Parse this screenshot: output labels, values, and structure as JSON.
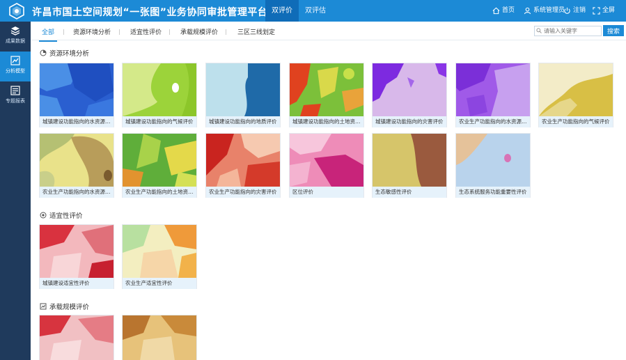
{
  "header": {
    "title": "许昌市国土空间规划“一张图”业务协同审批管理平台",
    "tabs": [
      "双评价",
      "双评估"
    ],
    "links": {
      "home": "首页",
      "user": "系统管理员",
      "logout": "注销",
      "fullscreen": "全屏"
    },
    "bg_color": "#1c8ad6"
  },
  "sidebar": {
    "items": [
      {
        "label": "成果数据",
        "icon": "layers-icon"
      },
      {
        "label": "分析模型",
        "icon": "chart-icon"
      },
      {
        "label": "专题报表",
        "icon": "report-icon"
      }
    ],
    "active_index": 1
  },
  "filters": {
    "tabs": [
      "全部",
      "资源环境分析",
      "适宜性评价",
      "承载规模评价",
      "三区三线划定"
    ],
    "active_index": 0,
    "search_placeholder": "请输入关键字",
    "search_button": "搜索"
  },
  "sections": [
    {
      "title": "资源环境分析",
      "icon": "pie-chart-icon",
      "cards": [
        "城镇建设功能指向的水资源评价",
        "城镇建设功能指向的气候评价",
        "城镇建设功能指向的地质评价",
        "城镇建设功能指向的土地资源评价",
        "城镇建设功能指向的灾害评价",
        "农业生产功能指向的水资源评价",
        "农业生产功能指向的气候评价",
        "农业生产功能指向的水资源评价",
        "农业生产功能指向的土地资源评价",
        "农业生产功能指向的灾害评价",
        "区位评价",
        "生态敏感性评价",
        "生态系统服务功能重要性评价"
      ]
    },
    {
      "title": "适宜性评价",
      "icon": "target-icon",
      "cards": [
        "城镇建设适宜性评价",
        "农业生产适宜性评价"
      ]
    },
    {
      "title": "承载规模评价",
      "icon": "scale-icon",
      "cards": [
        "",
        ""
      ]
    }
  ]
}
